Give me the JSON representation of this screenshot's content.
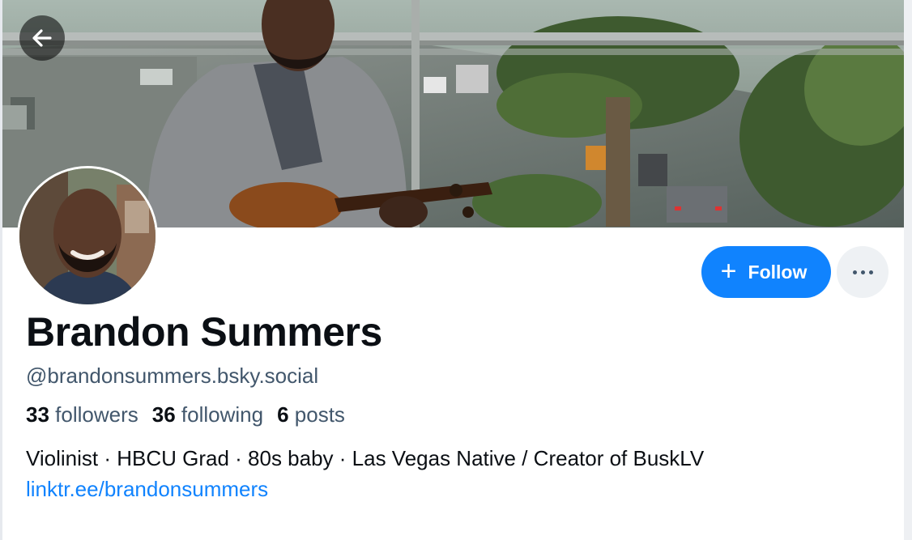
{
  "profile": {
    "display_name": "Brandon Summers",
    "handle": "@brandonsummers.bsky.social",
    "stats": {
      "followers_count": "33",
      "followers_label": "followers",
      "following_count": "36",
      "following_label": "following",
      "posts_count": "6",
      "posts_label": "posts"
    },
    "bio": "Violinist · HBCU Grad · 80s baby · Las Vegas Native / Creator of BuskLV",
    "link": "linktr.ee/brandonsummers"
  },
  "actions": {
    "follow_label": "Follow",
    "follow_icon": "plus-icon",
    "more_icon": "ellipsis-icon",
    "back_icon": "arrow-left-icon"
  },
  "colors": {
    "accent": "#1083fe",
    "secondary_text": "#42576c",
    "primary_text": "#0b0f14"
  }
}
